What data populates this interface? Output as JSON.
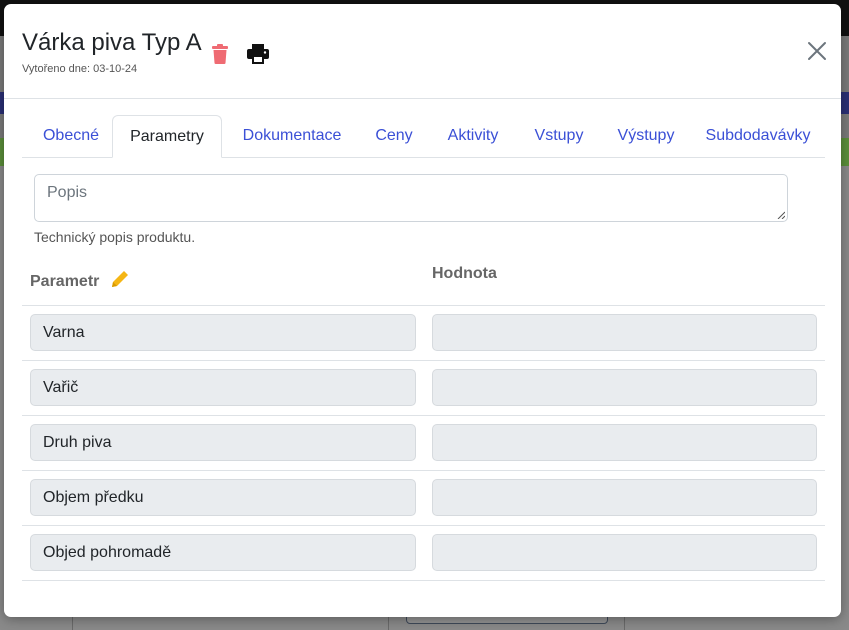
{
  "modal": {
    "title": "Várka piva Typ A",
    "subtitle": "Vytořeno dne: 03-10-24"
  },
  "icons": {
    "trash": "trash-icon",
    "print": "print-icon",
    "close": "close-icon",
    "edit": "pencil-icon"
  },
  "colors": {
    "trash": "#ef6b73",
    "edit": "#f5b614",
    "tab_link": "#3b50d6"
  },
  "tabs": [
    {
      "label": "Obecné",
      "active": false
    },
    {
      "label": "Parametry",
      "active": true
    },
    {
      "label": "Dokumentace",
      "active": false
    },
    {
      "label": "Ceny",
      "active": false
    },
    {
      "label": "Aktivity",
      "active": false
    },
    {
      "label": "Vstupy",
      "active": false
    },
    {
      "label": "Výstupy",
      "active": false
    },
    {
      "label": "Subdodavávky",
      "active": false
    }
  ],
  "description": {
    "placeholder": "Popis",
    "help": "Technický popis produktu."
  },
  "table": {
    "header_param": "Parametr",
    "header_value": "Hodnota",
    "rows": [
      {
        "name": "Varna",
        "value": ""
      },
      {
        "name": "Vařič",
        "value": ""
      },
      {
        "name": "Druh piva",
        "value": ""
      },
      {
        "name": "Objem předku",
        "value": ""
      },
      {
        "name": "Objed pohromadě",
        "value": ""
      }
    ]
  }
}
